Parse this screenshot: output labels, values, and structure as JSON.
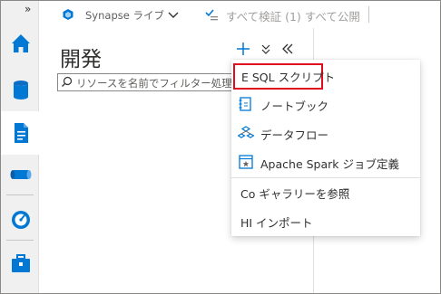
{
  "rail": {
    "collapse_glyph": "»",
    "items": [
      {
        "name": "home",
        "icon": "home-icon"
      },
      {
        "name": "data",
        "icon": "database-icon"
      },
      {
        "name": "develop",
        "icon": "document-icon",
        "active": true
      },
      {
        "name": "integrate",
        "icon": "pipeline-icon"
      },
      {
        "name": "monitor",
        "icon": "monitor-icon"
      },
      {
        "name": "manage",
        "icon": "toolbox-icon"
      }
    ],
    "accent_color": "#0078d4"
  },
  "topbar": {
    "synapse_label": "Synapse ライブ",
    "validate_label": "すべて検証 (1) すべて公開"
  },
  "panel": {
    "title": "開発",
    "add_glyph": "+",
    "collapse_glyph": "«",
    "search_placeholder": "リソースを名前でフィルター処理"
  },
  "menu": {
    "items": [
      {
        "label": "E SQL スクリプト",
        "highlighted": true
      },
      {
        "label": "ノートブック",
        "icon": "notebook-icon"
      },
      {
        "label": "データフロー",
        "icon": "dataflow-icon"
      },
      {
        "label": "Apache  Spark ジョブ定義",
        "icon": "spark-job-icon"
      },
      {
        "label": "Co ギャラリーを参照"
      },
      {
        "label": "HI インポート"
      }
    ],
    "highlight_color": "#e00b1c"
  }
}
